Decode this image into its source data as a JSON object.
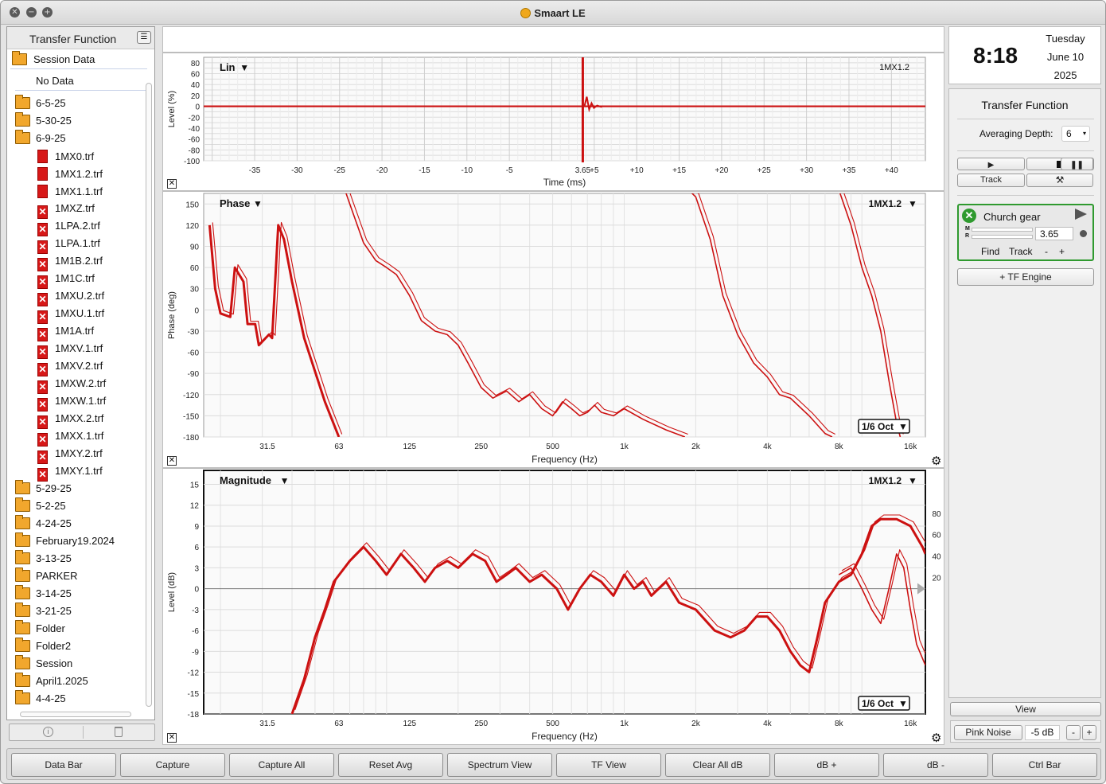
{
  "app": {
    "title": "Smaart LE"
  },
  "left_panel": {
    "title": "Transfer Function",
    "session_label": "Session Data",
    "no_data": "No Data",
    "tree": [
      {
        "type": "folder",
        "label": "6-5-25",
        "indent": 0
      },
      {
        "type": "folder",
        "label": "5-30-25",
        "indent": 0
      },
      {
        "type": "folder-open",
        "label": "6-9-25",
        "indent": 0
      },
      {
        "type": "file",
        "label": "1MX0.trf",
        "indent": 1
      },
      {
        "type": "file",
        "label": "1MX1.2.trf",
        "indent": 1
      },
      {
        "type": "file",
        "label": "1MX1.1.trf",
        "indent": 1
      },
      {
        "type": "file-x",
        "label": "1MXZ.trf",
        "indent": 1
      },
      {
        "type": "file-x",
        "label": "1LPA.2.trf",
        "indent": 1
      },
      {
        "type": "file-x",
        "label": "1LPA.1.trf",
        "indent": 1
      },
      {
        "type": "file-x",
        "label": "1M1B.2.trf",
        "indent": 1
      },
      {
        "type": "file-x",
        "label": "1M1C.trf",
        "indent": 1
      },
      {
        "type": "file-x",
        "label": "1MXU.2.trf",
        "indent": 1
      },
      {
        "type": "file-x",
        "label": "1MXU.1.trf",
        "indent": 1
      },
      {
        "type": "file-x",
        "label": "1M1A.trf",
        "indent": 1
      },
      {
        "type": "file-x",
        "label": "1MXV.1.trf",
        "indent": 1
      },
      {
        "type": "file-x",
        "label": "1MXV.2.trf",
        "indent": 1
      },
      {
        "type": "file-x",
        "label": "1MXW.2.trf",
        "indent": 1
      },
      {
        "type": "file-x",
        "label": "1MXW.1.trf",
        "indent": 1
      },
      {
        "type": "file-x",
        "label": "1MXX.2.trf",
        "indent": 1
      },
      {
        "type": "file-x",
        "label": "1MXX.1.trf",
        "indent": 1
      },
      {
        "type": "file-x",
        "label": "1MXY.2.trf",
        "indent": 1
      },
      {
        "type": "file-x",
        "label": "1MXY.1.trf",
        "indent": 1
      },
      {
        "type": "folder",
        "label": "5-29-25",
        "indent": 0
      },
      {
        "type": "folder",
        "label": "5-2-25",
        "indent": 0
      },
      {
        "type": "folder",
        "label": "4-24-25",
        "indent": 0
      },
      {
        "type": "folder",
        "label": "February19.2024",
        "indent": 0
      },
      {
        "type": "folder",
        "label": "3-13-25",
        "indent": 0
      },
      {
        "type": "folder",
        "label": "PARKER",
        "indent": 0
      },
      {
        "type": "folder",
        "label": "3-14-25",
        "indent": 0
      },
      {
        "type": "folder",
        "label": "3-21-25",
        "indent": 0
      },
      {
        "type": "folder",
        "label": "Folder",
        "indent": 0
      },
      {
        "type": "folder",
        "label": "Folder2",
        "indent": 0
      },
      {
        "type": "folder",
        "label": "Session",
        "indent": 0
      },
      {
        "type": "folder",
        "label": "April1.2025",
        "indent": 0
      },
      {
        "type": "folder",
        "label": "4-4-25",
        "indent": 0
      }
    ]
  },
  "clock": {
    "time": "8:18",
    "weekday": "Tuesday",
    "date": "June 10",
    "year": "2025"
  },
  "right_panel": {
    "title": "Transfer Function",
    "averaging_label": "Averaging Depth:",
    "averaging_value": "6",
    "track_label": "Track",
    "measurement": {
      "name": "Church gear",
      "delay": "3.65",
      "find": "Find",
      "track": "Track",
      "minus": "-",
      "plus": "+",
      "meter_m": "M",
      "meter_r": "R"
    },
    "add_engine": "+ TF Engine",
    "view_label": "View",
    "generator_label": "Pink Noise",
    "generator_level": "-5 dB",
    "gen_minus": "-",
    "gen_plus": "+"
  },
  "bottom_bar": [
    "Data Bar",
    "Capture",
    "Capture All",
    "Reset Avg",
    "Spectrum View",
    "TF View",
    "Clear All dB",
    "dB +",
    "dB -",
    "Ctrl Bar"
  ],
  "colors": {
    "trace": "#cc1111",
    "accent_green": "#2f9a2f"
  },
  "chart_data": [
    {
      "type": "line",
      "name": "impulse",
      "title": "Lin",
      "trace_label": "1MX1.2",
      "xlabel": "Time (ms)",
      "ylabel": "Level (%)",
      "x_ticks": [
        "-35",
        "-30",
        "-25",
        "-20",
        "-15",
        "-10",
        "-5",
        "3.65",
        "+5",
        "+10",
        "+15",
        "+20",
        "+25",
        "+30",
        "+35",
        "+40"
      ],
      "y_ticks": [
        "80",
        "60",
        "40",
        "20",
        "0",
        "-20",
        "-40",
        "-60",
        "-80",
        "-100"
      ],
      "xlim": [
        -41,
        44
      ],
      "ylim": [
        -100,
        90
      ],
      "peak_x": 3.65
    },
    {
      "type": "line",
      "name": "phase",
      "title": "Phase",
      "trace_label": "1MX1.2",
      "smoothing": "1/6 Oct",
      "xlabel": "Frequency (Hz)",
      "ylabel": "Phase (deg)",
      "x_ticks": [
        "31.5",
        "63",
        "125",
        "250",
        "500",
        "1k",
        "2k",
        "4k",
        "8k",
        "16k"
      ],
      "y_ticks": [
        "150",
        "120",
        "90",
        "60",
        "30",
        "0",
        "-30",
        "-60",
        "-90",
        "-120",
        "-150",
        "-180"
      ],
      "xscale": "log",
      "xlim": [
        17,
        18500
      ],
      "ylim": [
        -180,
        165
      ],
      "series": [
        {
          "values": [
            [
              18,
              120
            ],
            [
              19,
              30
            ],
            [
              20,
              -5
            ],
            [
              22,
              -10
            ],
            [
              23,
              60
            ],
            [
              25,
              40
            ],
            [
              26,
              -20
            ],
            [
              28,
              -20
            ],
            [
              29,
              -50
            ],
            [
              32,
              -35
            ],
            [
              33,
              -40
            ],
            [
              35,
              120
            ],
            [
              37,
              100
            ],
            [
              40,
              40
            ],
            [
              45,
              -40
            ],
            [
              55,
              -130
            ],
            [
              63,
              -180
            ]
          ]
        },
        {
          "values": [
            [
              66,
              175
            ],
            [
              70,
              150
            ],
            [
              80,
              95
            ],
            [
              90,
              70
            ],
            [
              100,
              60
            ],
            [
              110,
              50
            ],
            [
              125,
              20
            ],
            [
              140,
              -15
            ],
            [
              160,
              -30
            ],
            [
              180,
              -35
            ],
            [
              200,
              -50
            ],
            [
              220,
              -75
            ],
            [
              250,
              -110
            ],
            [
              280,
              -125
            ],
            [
              320,
              -115
            ],
            [
              360,
              -130
            ],
            [
              400,
              -120
            ],
            [
              450,
              -140
            ],
            [
              500,
              -150
            ],
            [
              550,
              -130
            ],
            [
              600,
              -140
            ],
            [
              650,
              -150
            ],
            [
              700,
              -145
            ],
            [
              750,
              -135
            ],
            [
              800,
              -145
            ],
            [
              900,
              -150
            ],
            [
              1000,
              -140
            ],
            [
              1200,
              -155
            ],
            [
              1500,
              -170
            ],
            [
              1800,
              -180
            ]
          ]
        },
        {
          "values": [
            [
              1800,
              175
            ],
            [
              2000,
              160
            ],
            [
              2300,
              100
            ],
            [
              2600,
              20
            ],
            [
              3000,
              -35
            ],
            [
              3500,
              -75
            ],
            [
              4000,
              -95
            ],
            [
              4500,
              -120
            ],
            [
              5000,
              -125
            ],
            [
              6000,
              -150
            ],
            [
              7000,
              -175
            ],
            [
              7500,
              -180
            ]
          ]
        },
        {
          "values": [
            [
              8000,
              170
            ],
            [
              9000,
              120
            ],
            [
              10000,
              60
            ],
            [
              11000,
              20
            ],
            [
              12000,
              -30
            ],
            [
              13000,
              -100
            ],
            [
              14000,
              -160
            ],
            [
              14500,
              -180
            ]
          ]
        }
      ]
    },
    {
      "type": "line",
      "name": "magnitude",
      "title": "Magnitude",
      "trace_label": "1MX1.2",
      "smoothing": "1/6 Oct",
      "xlabel": "Frequency (Hz)",
      "ylabel": "Level (dB)",
      "x_ticks": [
        "31.5",
        "63",
        "125",
        "250",
        "500",
        "1k",
        "2k",
        "4k",
        "8k",
        "16k"
      ],
      "y_ticks": [
        "15",
        "12",
        "9",
        "6",
        "3",
        "0",
        "-3",
        "-6",
        "-9",
        "-12",
        "-15",
        "-18"
      ],
      "y2_ticks": [
        "80",
        "60",
        "40",
        "20"
      ],
      "xscale": "log",
      "xlim": [
        17,
        18500
      ],
      "ylim": [
        -18,
        17
      ],
      "series": [
        {
          "values": [
            [
              40,
              -18
            ],
            [
              45,
              -13
            ],
            [
              50,
              -7
            ],
            [
              55,
              -3
            ],
            [
              60,
              1
            ],
            [
              70,
              4
            ],
            [
              80,
              6
            ],
            [
              90,
              4
            ],
            [
              100,
              2
            ],
            [
              115,
              5
            ],
            [
              130,
              3
            ],
            [
              145,
              1
            ],
            [
              160,
              3
            ],
            [
              180,
              4
            ],
            [
              200,
              3
            ],
            [
              230,
              5
            ],
            [
              260,
              4
            ],
            [
              290,
              1
            ],
            [
              320,
              2
            ],
            [
              350,
              3
            ],
            [
              400,
              1
            ],
            [
              450,
              2
            ],
            [
              520,
              0
            ],
            [
              580,
              -3
            ],
            [
              650,
              0
            ],
            [
              720,
              2
            ],
            [
              800,
              1
            ],
            [
              900,
              -1
            ],
            [
              1000,
              2
            ],
            [
              1100,
              0
            ],
            [
              1200,
              1
            ],
            [
              1300,
              -1
            ],
            [
              1500,
              1
            ],
            [
              1700,
              -2
            ],
            [
              2000,
              -3
            ],
            [
              2400,
              -6
            ],
            [
              2800,
              -7
            ],
            [
              3200,
              -6
            ],
            [
              3600,
              -4
            ],
            [
              4000,
              -4
            ],
            [
              4500,
              -6
            ],
            [
              5000,
              -9
            ],
            [
              5500,
              -11
            ],
            [
              6000,
              -12
            ],
            [
              6500,
              -7
            ],
            [
              7000,
              -2
            ],
            [
              8000,
              1
            ],
            [
              9000,
              2
            ],
            [
              10000,
              5
            ],
            [
              11000,
              9
            ],
            [
              12000,
              10
            ],
            [
              14000,
              10
            ],
            [
              16000,
              9
            ],
            [
              18000,
              6
            ],
            [
              18500,
              5
            ]
          ]
        },
        {
          "values": [
            [
              8000,
              2
            ],
            [
              9000,
              3
            ],
            [
              10000,
              0
            ],
            [
              11000,
              -3
            ],
            [
              12000,
              -5
            ],
            [
              13000,
              0
            ],
            [
              14000,
              5
            ],
            [
              15000,
              3
            ],
            [
              16000,
              -3
            ],
            [
              17000,
              -8
            ],
            [
              18500,
              -11
            ]
          ]
        }
      ]
    }
  ]
}
